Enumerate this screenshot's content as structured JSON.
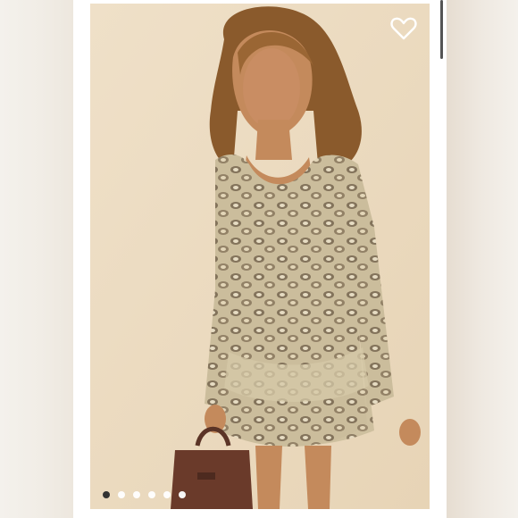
{
  "listing": {
    "photo_alt": "",
    "like_icon": "heart-outline-icon",
    "carousel": {
      "total": 6,
      "active_index": 0
    }
  },
  "colors": {
    "backdrop": "#eddcc2",
    "dot_active": "#333333",
    "dot_inactive": "#ffffff"
  }
}
